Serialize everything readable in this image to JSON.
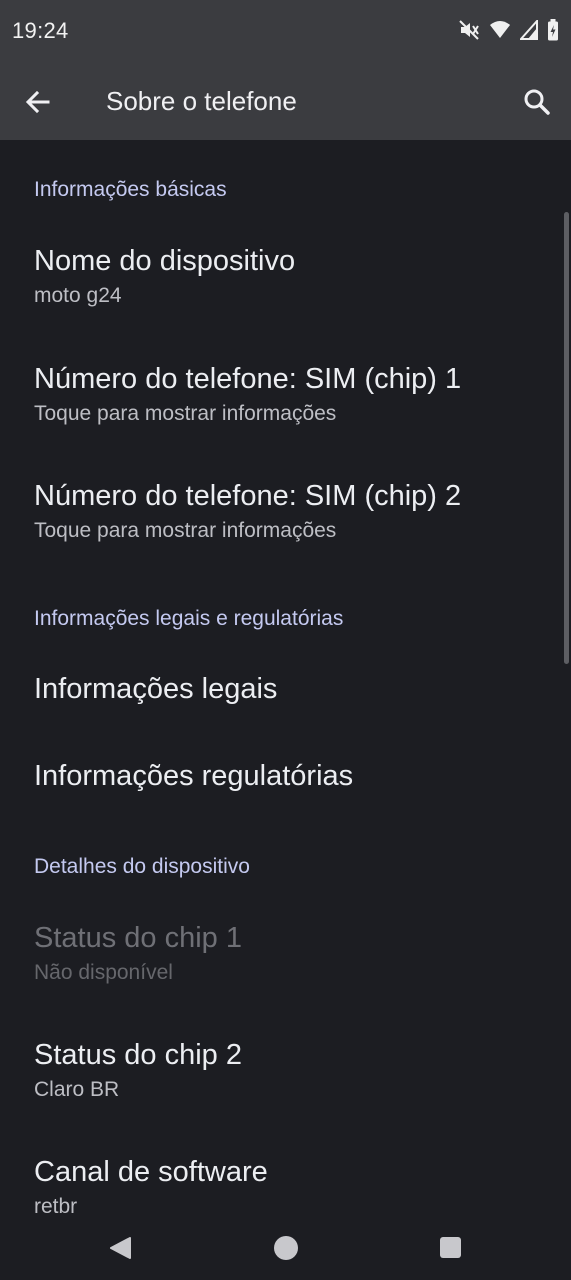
{
  "status_bar": {
    "time": "19:24",
    "icons": [
      "mute-vibrate-icon",
      "wifi-icon",
      "signal-icon",
      "battery-icon"
    ]
  },
  "app_bar": {
    "title": "Sobre o telefone",
    "back_icon": "back-arrow-icon",
    "search_icon": "search-icon"
  },
  "sections": {
    "basic": {
      "header": "Informações básicas",
      "device_name": {
        "title": "Nome do dispositivo",
        "summary": "moto g24"
      },
      "phone_sim1": {
        "title": "Número do telefone: SIM (chip) 1",
        "summary": "Toque para mostrar informações"
      },
      "phone_sim2": {
        "title": "Número do telefone: SIM (chip) 2",
        "summary": "Toque para mostrar informações"
      }
    },
    "legal": {
      "header": "Informações legais e regulatórias",
      "legal_info": {
        "title": "Informações legais"
      },
      "regulatory_info": {
        "title": "Informações regulatórias"
      }
    },
    "device": {
      "header": "Detalhes do dispositivo",
      "sim1_status": {
        "title": "Status do chip 1",
        "summary": "Não disponível",
        "enabled": false
      },
      "sim2_status": {
        "title": "Status do chip 2",
        "summary": "Claro BR"
      },
      "software_channel": {
        "title": "Canal de software",
        "summary": "retbr"
      }
    }
  },
  "colors": {
    "background": "#1c1d22",
    "app_bar": "#3b3c40",
    "section_header": "#c4c9f0",
    "disabled_text": "#6f7076"
  }
}
